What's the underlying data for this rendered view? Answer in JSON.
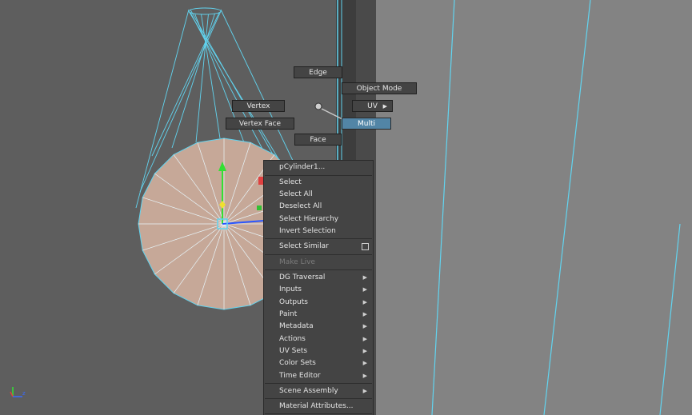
{
  "marking_menu": {
    "edge": "Edge",
    "object_mode": "Object Mode",
    "vertex": "Vertex",
    "uv": "UV",
    "vertex_face": "Vertex Face",
    "multi": "Multi",
    "face": "Face"
  },
  "context_menu": {
    "object_name": "pCylinder1...",
    "items": {
      "select": "Select",
      "select_all": "Select All",
      "deselect_all": "Deselect All",
      "select_hierarchy": "Select Hierarchy",
      "invert_selection": "Invert Selection",
      "select_similar": "Select Similar",
      "make_live": "Make Live",
      "dg_traversal": "DG Traversal",
      "inputs": "Inputs",
      "outputs": "Outputs",
      "paint": "Paint",
      "metadata": "Metadata",
      "actions": "Actions",
      "uv_sets": "UV Sets",
      "color_sets": "Color Sets",
      "time_editor": "Time Editor",
      "scene_assembly": "Scene Assembly",
      "material_attributes": "Material Attributes..."
    },
    "submenu_arrow": "▶"
  },
  "colors": {
    "wireframe": "#61d4f0",
    "face_fill": "#c6a898",
    "active_item": "#5285a6",
    "menu_bg": "#444444"
  },
  "icons": [
    "submenu-arrow-icon",
    "option-box-icon",
    "view-axis-icon",
    "move-manipulator-icon"
  ]
}
